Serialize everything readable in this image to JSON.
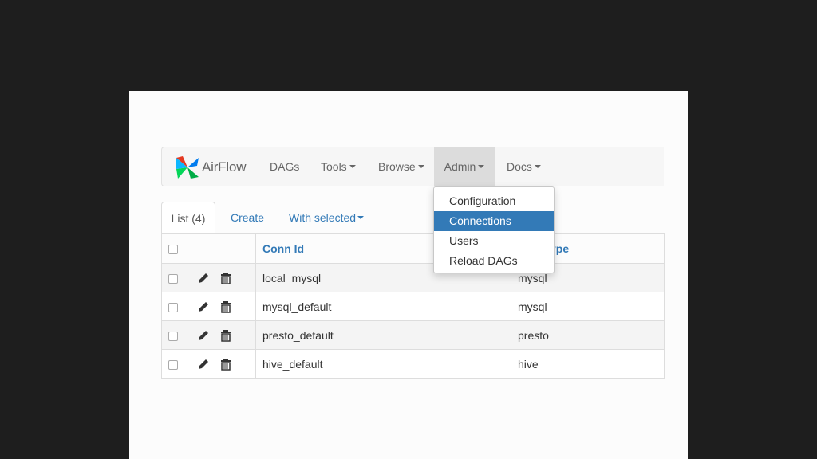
{
  "brand": {
    "name": "AirFlow"
  },
  "nav": {
    "items": [
      {
        "label": "DAGs"
      },
      {
        "label": "Tools"
      },
      {
        "label": "Browse"
      },
      {
        "label": "Admin"
      },
      {
        "label": "Docs"
      }
    ]
  },
  "admin_menu": {
    "items": [
      {
        "label": "Configuration"
      },
      {
        "label": "Connections"
      },
      {
        "label": "Users"
      },
      {
        "label": "Reload DAGs"
      }
    ],
    "active": "Connections"
  },
  "tabs": {
    "list": "List (4)",
    "create": "Create",
    "with_selected": "With selected"
  },
  "table": {
    "headers": {
      "conn_id": "Conn Id",
      "conn_type": "ype"
    },
    "rows": [
      {
        "conn_id": "local_mysql",
        "conn_type": "mysql"
      },
      {
        "conn_id": "mysql_default",
        "conn_type": "mysql"
      },
      {
        "conn_id": "presto_default",
        "conn_type": "presto"
      },
      {
        "conn_id": "hive_default",
        "conn_type": "hive"
      }
    ],
    "row_icons": [
      "pencil-icon",
      "trash-icon"
    ]
  },
  "colors": {
    "accent": "#337ab7",
    "page": "#1e1e1e",
    "navbar": "#f6f6f6"
  }
}
